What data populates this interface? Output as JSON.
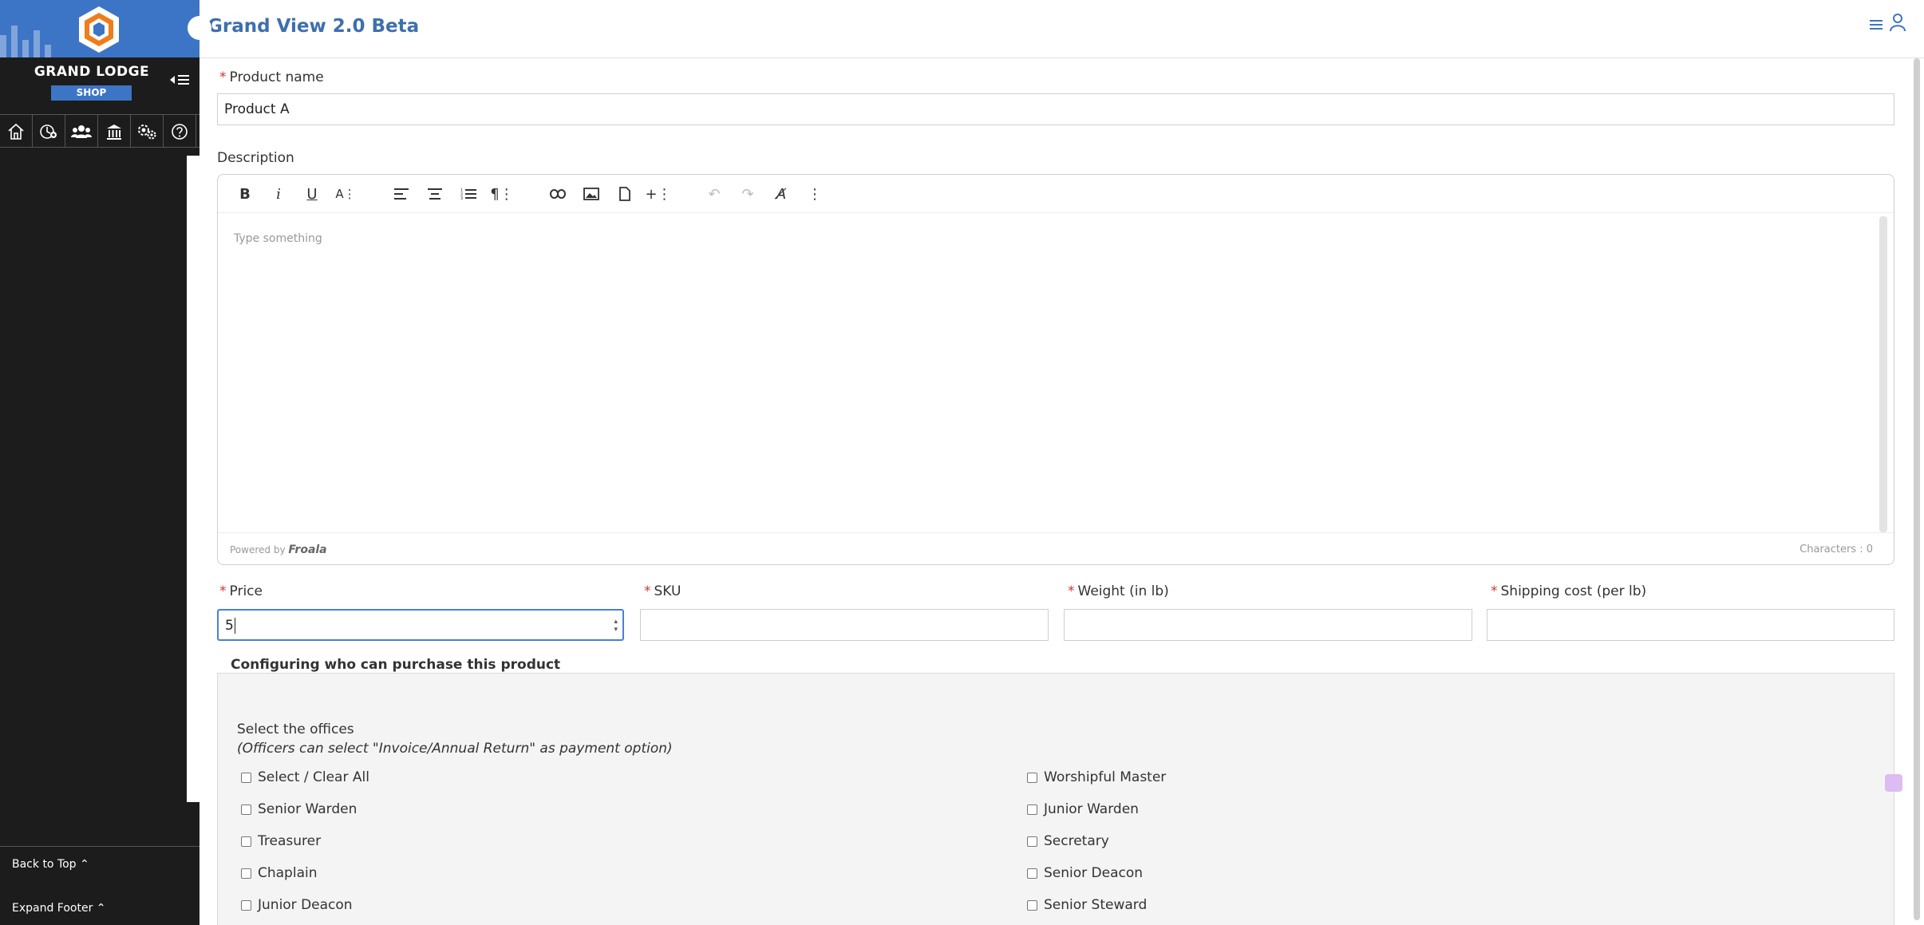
{
  "header": {
    "app_title": "Grand View 2.0 Beta",
    "menu_icon": "hamburger-icon",
    "user_icon": "user-icon"
  },
  "sidebar": {
    "title": "GRAND LODGE",
    "badge": "SHOP",
    "icons": [
      "home-icon",
      "dashboard-plus-icon",
      "members-icon",
      "lodge-building-icon",
      "settings-gears-icon",
      "help-icon"
    ],
    "back_to_top": "Back to Top ⌃",
    "expand_footer": "Expand Footer ⌃"
  },
  "form": {
    "product_name_label": "Product name",
    "product_name_value": "Product A",
    "description_label": "Description",
    "editor": {
      "placeholder": "Type something",
      "powered_by": "Powered by",
      "powered_brand": "Froala",
      "char_count": "Characters : 0"
    },
    "price_label": "Price",
    "price_value": "5",
    "sku_label": "SKU",
    "sku_value": "",
    "weight_label": "Weight (in lb)",
    "weight_value": "",
    "shipping_label": "Shipping cost (per lb)",
    "shipping_value": ""
  },
  "purchase_config": {
    "legend": "Configuring who can purchase this product",
    "offices_heading": "Select the offices",
    "offices_note": "(Officers can select \"Invoice/Annual Return\" as payment option)",
    "checkboxes": [
      {
        "label": "Select / Clear All",
        "checked": false
      },
      {
        "label": "Worshipful Master",
        "checked": false
      },
      {
        "label": "Senior Warden",
        "checked": false
      },
      {
        "label": "Junior Warden",
        "checked": false
      },
      {
        "label": "Treasurer",
        "checked": false
      },
      {
        "label": "Secretary",
        "checked": false
      },
      {
        "label": "Chaplain",
        "checked": false
      },
      {
        "label": "Senior Deacon",
        "checked": false
      },
      {
        "label": "Junior Deacon",
        "checked": false
      },
      {
        "label": "Senior Steward",
        "checked": false
      }
    ]
  },
  "colors": {
    "brand_blue": "#3d75c6",
    "sidebar_bg": "#1c1c1c",
    "required_star": "#d9342b",
    "focus_border": "#4a80d6"
  }
}
